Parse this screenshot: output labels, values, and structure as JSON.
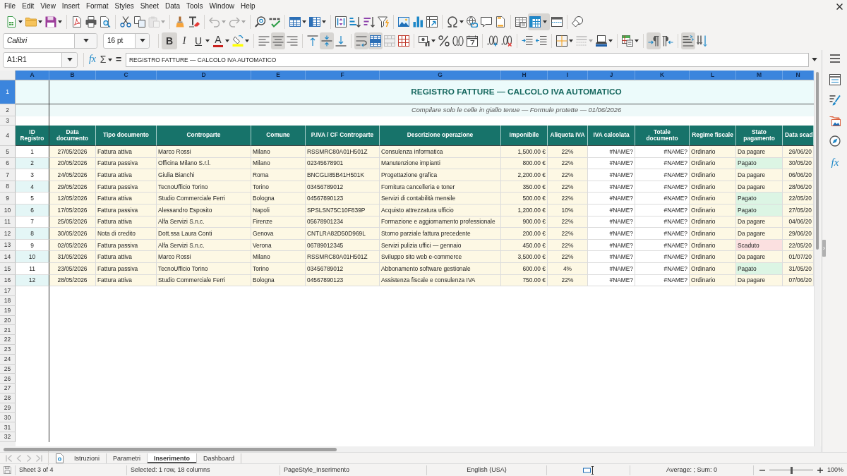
{
  "menu_bar": [
    "File",
    "Edit",
    "View",
    "Insert",
    "Format",
    "Styles",
    "Sheet",
    "Data",
    "Tools",
    "Window",
    "Help"
  ],
  "standard_toolbar": {
    "paste": {
      "disabled": true
    },
    "undo": {
      "disabled": true
    },
    "redo": {
      "disabled": true
    },
    "freeze_rows_and_columns": {
      "on": true
    }
  },
  "formatting_toolbar": {
    "font_name": "Calibri",
    "font_size": "16 pt",
    "bold": {
      "label": "B",
      "on": true
    },
    "italic": {
      "label": "I",
      "on": false
    },
    "underline": {
      "label": "U",
      "on": false
    },
    "font_color": {
      "label": "A"
    },
    "horizontal_align": [
      {
        "kind": "left",
        "selected": false
      },
      {
        "kind": "center",
        "selected": true
      },
      {
        "kind": "right",
        "selected": false
      }
    ],
    "vertical_align": [
      {
        "kind": "top",
        "selected": false
      },
      {
        "kind": "center",
        "selected": true
      },
      {
        "kind": "bottom",
        "selected": false
      }
    ],
    "wrap_text": {
      "on": true
    },
    "merge_and_center": {
      "on": true
    },
    "paragraph_direction": [
      {
        "kind": "left-to-right",
        "selected": true
      },
      {
        "kind": "right-to-left",
        "selected": false
      }
    ],
    "text_direction": [
      {
        "kind": "horizontal",
        "selected": true
      },
      {
        "kind": "vertical",
        "selected": false
      }
    ]
  },
  "formula_bar": {
    "name_box": "A1:R1",
    "function_wizard": "fx",
    "sum": "Σ",
    "equals": "=",
    "content": "REGISTRO FATTURE — CALCOLO IVA AUTOMATICO"
  },
  "sheet": {
    "columns": [
      {
        "label": "A",
        "selected": true
      },
      {
        "label": "B",
        "selected": true
      },
      {
        "label": "C",
        "selected": true
      },
      {
        "label": "D",
        "selected": true
      },
      {
        "label": "E",
        "selected": true
      },
      {
        "label": "F",
        "selected": true
      },
      {
        "label": "G",
        "selected": true
      },
      {
        "label": "H",
        "selected": true
      },
      {
        "label": "I",
        "selected": true
      },
      {
        "label": "J",
        "selected": true
      },
      {
        "label": "K",
        "selected": true
      },
      {
        "label": "L",
        "selected": true
      },
      {
        "label": "M",
        "selected": true
      },
      {
        "label": "N",
        "selected": true
      }
    ],
    "row_numbers": [
      {
        "label": "1",
        "selected": true
      },
      {
        "label": "2",
        "selected": false
      },
      {
        "label": "3",
        "selected": false
      },
      {
        "label": "4",
        "selected": false
      },
      {
        "label": "5",
        "selected": false
      },
      {
        "label": "6",
        "selected": false
      },
      {
        "label": "7",
        "selected": false
      },
      {
        "label": "8",
        "selected": false
      },
      {
        "label": "9",
        "selected": false
      },
      {
        "label": "10",
        "selected": false
      },
      {
        "label": "11",
        "selected": false
      },
      {
        "label": "12",
        "selected": false
      },
      {
        "label": "13",
        "selected": false
      },
      {
        "label": "14",
        "selected": false
      },
      {
        "label": "15",
        "selected": false
      },
      {
        "label": "16",
        "selected": false
      },
      {
        "label": "17",
        "selected": false
      },
      {
        "label": "18",
        "selected": false
      },
      {
        "label": "19",
        "selected": false
      },
      {
        "label": "20",
        "selected": false
      },
      {
        "label": "21",
        "selected": false
      },
      {
        "label": "22",
        "selected": false
      },
      {
        "label": "23",
        "selected": false
      },
      {
        "label": "24",
        "selected": false
      },
      {
        "label": "25",
        "selected": false
      },
      {
        "label": "26",
        "selected": false
      },
      {
        "label": "27",
        "selected": false
      },
      {
        "label": "28",
        "selected": false
      },
      {
        "label": "29",
        "selected": false
      },
      {
        "label": "30",
        "selected": false
      },
      {
        "label": "31",
        "selected": false
      },
      {
        "label": "32",
        "selected": false
      }
    ],
    "title": "REGISTRO FATTURE — CALCOLO IVA AUTOMATICO",
    "subtitle": "Compilare solo le celle in giallo tenue — Formule protette — 01/06/2026",
    "header": [
      "ID Registro",
      "Data documento",
      "Tipo documento",
      "Controparte",
      "Comune",
      "P.IVA / CF Controparte",
      "Descrizione operazione",
      "Imponibile",
      "Aliquota IVA",
      "IVA calcolata",
      "Totale documento",
      "Regime fiscale",
      "Stato pagamento",
      "Data scad"
    ],
    "rows": [
      {
        "cells": [
          "1",
          "27/05/2026",
          "Fattura attiva",
          "Marco Rossi",
          "Milano",
          "RSSMRC80A01H501Z",
          "Consulenza informatica",
          "1,500.00 €",
          "22%",
          "#NAME?",
          "#NAME?",
          "Ordinario",
          "Da pagare",
          "26/06/20"
        ],
        "color": "#fdf8e4"
      },
      {
        "cells": [
          "2",
          "20/05/2026",
          "Fattura passiva",
          "Officina Milano S.r.l.",
          "Milano",
          "02345678901",
          "Manutenzione impianti",
          "800.00 €",
          "22%",
          "#NAME?",
          "#NAME?",
          "Ordinario",
          "Pagato",
          "30/05/20"
        ],
        "color": "#dcf5e4"
      },
      {
        "cells": [
          "3",
          "24/05/2026",
          "Fattura attiva",
          "Giulia Bianchi",
          "Roma",
          "BNCGLI85B41H501K",
          "Progettazione grafica",
          "2,200.00 €",
          "22%",
          "#NAME?",
          "#NAME?",
          "Ordinario",
          "Da pagare",
          "06/06/20"
        ],
        "color": "#fdf8e4"
      },
      {
        "cells": [
          "4",
          "29/05/2026",
          "Fattura passiva",
          "TecnoUfficio Torino",
          "Torino",
          "03456789012",
          "Fornitura cancelleria e toner",
          "350.00 €",
          "22%",
          "#NAME?",
          "#NAME?",
          "Ordinario",
          "Da pagare",
          "28/06/20"
        ],
        "color": "#fdf8e4"
      },
      {
        "cells": [
          "5",
          "12/05/2026",
          "Fattura attiva",
          "Studio Commerciale Ferri",
          "Bologna",
          "04567890123",
          "Servizi di contabilità mensile",
          "500.00 €",
          "22%",
          "#NAME?",
          "#NAME?",
          "Ordinario",
          "Pagato",
          "22/05/20"
        ],
        "color": "#dcf5e4"
      },
      {
        "cells": [
          "6",
          "17/05/2026",
          "Fattura passiva",
          "Alessandro Esposito",
          "Napoli",
          "SPSLSN75C10F839P",
          "Acquisto attrezzatura ufficio",
          "1,200.00 €",
          "10%",
          "#NAME?",
          "#NAME?",
          "Ordinario",
          "Pagato",
          "27/05/20"
        ],
        "color": "#dcf5e4"
      },
      {
        "cells": [
          "7",
          "25/05/2026",
          "Fattura attiva",
          "Alfa Servizi S.n.c.",
          "Firenze",
          "05678901234",
          "Formazione e aggiornamento professionale",
          "900.00 €",
          "22%",
          "#NAME?",
          "#NAME?",
          "Ordinario",
          "Da pagare",
          "04/06/20"
        ],
        "color": "#fdf8e4"
      },
      {
        "cells": [
          "8",
          "30/05/2026",
          "Nota di credito",
          "Dott.ssa Laura Conti",
          "Genova",
          "CNTLRA82D50D969L",
          "Storno parziale fattura precedente",
          "200.00 €",
          "22%",
          "#NAME?",
          "#NAME?",
          "Ordinario",
          "Da pagare",
          "29/06/20"
        ],
        "color": "#fdf8e4"
      },
      {
        "cells": [
          "9",
          "02/05/2026",
          "Fattura passiva",
          "Alfa Servizi S.n.c.",
          "Verona",
          "06789012345",
          "Servizi pulizia uffici — gennaio",
          "450.00 €",
          "22%",
          "#NAME?",
          "#NAME?",
          "Ordinario",
          "Scaduto",
          "22/05/20"
        ],
        "color": "#fbe0e0"
      },
      {
        "cells": [
          "10",
          "31/05/2026",
          "Fattura attiva",
          "Marco Rossi",
          "Milano",
          "RSSMRC80A01H501Z",
          "Sviluppo sito web e-commerce",
          "3,500.00 €",
          "22%",
          "#NAME?",
          "#NAME?",
          "Ordinario",
          "Da pagare",
          "01/07/20"
        ],
        "color": "#fdf8e4"
      },
      {
        "cells": [
          "11",
          "23/05/2026",
          "Fattura passiva",
          "TecnoUfficio Torino",
          "Torino",
          "03456789012",
          "Abbonamento software gestionale",
          "600.00 €",
          "4%",
          "#NAME?",
          "#NAME?",
          "Ordinario",
          "Pagato",
          "31/05/20"
        ],
        "color": "#dcf5e4"
      },
      {
        "cells": [
          "12",
          "28/05/2026",
          "Fattura attiva",
          "Studio Commerciale Ferri",
          "Bologna",
          "04567890123",
          "Assistenza fiscale e consulenza IVA",
          "750.00 €",
          "22%",
          "#NAME?",
          "#NAME?",
          "Ordinario",
          "Da pagare",
          "07/06/20"
        ],
        "color": "#fdf8e4"
      }
    ]
  },
  "sheet_tabs": [
    {
      "label": "Istruzioni",
      "selected": false
    },
    {
      "label": "Parametri",
      "selected": false
    },
    {
      "label": "Inserimento",
      "selected": true
    },
    {
      "label": "Dashboard",
      "selected": false
    }
  ],
  "status_bar": {
    "sheet_position": "Sheet 3 of 4",
    "selection": "Selected: 1 row, 18 columns",
    "page_style": "PageStyle_Inserimento",
    "language": "English (USA)",
    "statistics": "Average: ; Sum: 0",
    "zoom": {
      "level": 0.5
    },
    "zoom_reading": "100%"
  },
  "sidebar": {
    "functions": "fx"
  }
}
